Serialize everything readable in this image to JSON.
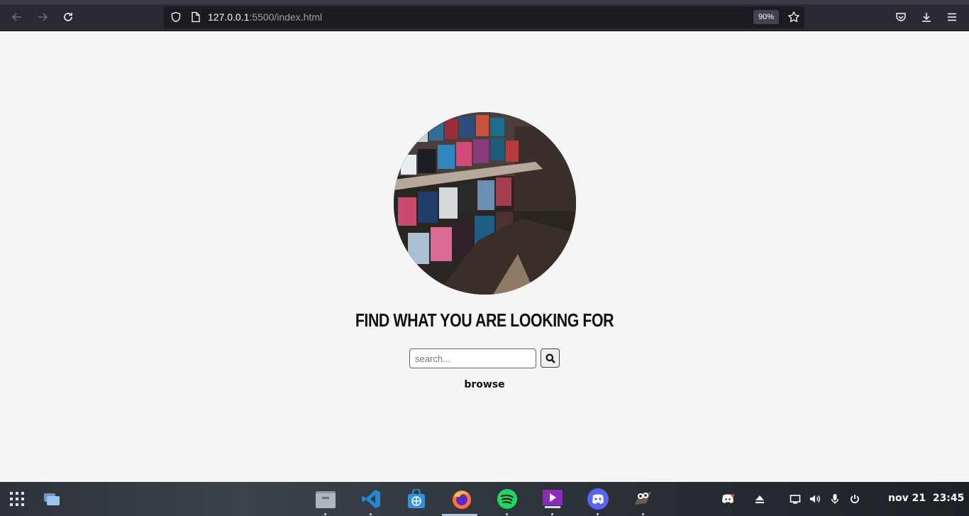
{
  "browser": {
    "url_host": "127.0.0.1",
    "url_port_path": ":5500/index.html",
    "zoom": "90%"
  },
  "page": {
    "heading": "FIND WHAT YOU ARE LOOKING FOR",
    "search_placeholder": "search...",
    "browse_label": "browse"
  },
  "taskbar": {
    "apps": [
      "files",
      "vscode",
      "store",
      "firefox",
      "spotify",
      "video",
      "discord",
      "gimp"
    ],
    "clock_date": "nov 21",
    "clock_time": "23:45"
  }
}
